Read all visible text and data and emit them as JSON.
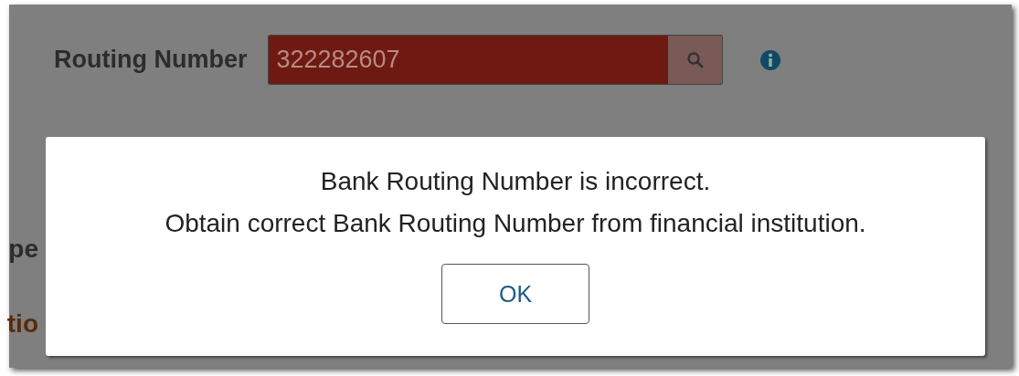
{
  "form": {
    "routing_label": "Routing Number",
    "routing_value": "322282607",
    "routing_invalid": true,
    "cut_labels": [
      {
        "text": "pe",
        "kind": "plain"
      },
      {
        "text": "tio",
        "kind": "section"
      }
    ]
  },
  "dialog": {
    "lines": [
      "Bank Routing Number is incorrect.",
      "Obtain correct Bank Routing Number from financial institution."
    ],
    "button": "OK"
  }
}
